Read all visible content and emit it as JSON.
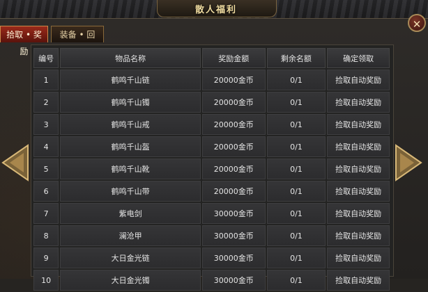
{
  "window": {
    "title": "散人福利",
    "close_glyph": "✕"
  },
  "tabs": [
    {
      "label": "拾取 • 奖励",
      "active": true
    },
    {
      "label": "装备 • 回收",
      "active": false
    }
  ],
  "table": {
    "headers": [
      "编号",
      "物品名称",
      "奖励金额",
      "剩余名额",
      "确定领取"
    ],
    "rows": [
      {
        "no": "1",
        "name": "鹤鸣千山链",
        "reward": "20000金币",
        "remaining": "0/1",
        "action": "捡取自动奖励"
      },
      {
        "no": "2",
        "name": "鹤鸣千山镯",
        "reward": "20000金币",
        "remaining": "0/1",
        "action": "捡取自动奖励"
      },
      {
        "no": "3",
        "name": "鹤鸣千山戒",
        "reward": "20000金币",
        "remaining": "0/1",
        "action": "捡取自动奖励"
      },
      {
        "no": "4",
        "name": "鹤鸣千山盔",
        "reward": "20000金币",
        "remaining": "0/1",
        "action": "捡取自动奖励"
      },
      {
        "no": "5",
        "name": "鹤鸣千山靴",
        "reward": "20000金币",
        "remaining": "0/1",
        "action": "捡取自动奖励"
      },
      {
        "no": "6",
        "name": "鹤鸣千山带",
        "reward": "20000金币",
        "remaining": "0/1",
        "action": "捡取自动奖励"
      },
      {
        "no": "7",
        "name": "紫电剑",
        "reward": "30000金币",
        "remaining": "0/1",
        "action": "捡取自动奖励"
      },
      {
        "no": "8",
        "name": "澜沧甲",
        "reward": "30000金币",
        "remaining": "0/1",
        "action": "捡取自动奖励"
      },
      {
        "no": "9",
        "name": "大日金光链",
        "reward": "30000金币",
        "remaining": "0/1",
        "action": "捡取自动奖励"
      },
      {
        "no": "10",
        "name": "大日金光镯",
        "reward": "30000金币",
        "remaining": "0/1",
        "action": "捡取自动奖励"
      }
    ]
  },
  "colors": {
    "item_name": "#e040e8",
    "reward": "#e01818",
    "action": "#f0d858",
    "title": "#f0dca0"
  },
  "icons": {
    "prev": "left-arrow-icon",
    "next": "right-arrow-icon",
    "close": "close-icon"
  }
}
